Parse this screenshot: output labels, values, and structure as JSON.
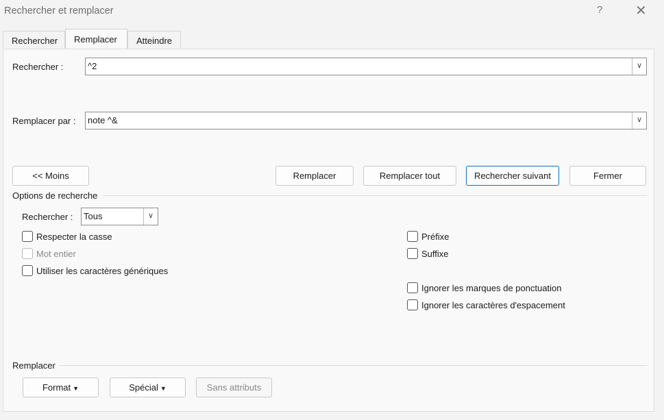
{
  "window": {
    "title": "Rechercher et remplacer",
    "help": "?",
    "close": "✕"
  },
  "tabs": [
    {
      "label": "Rechercher",
      "active": false
    },
    {
      "label": "Remplacer",
      "active": true
    },
    {
      "label": "Atteindre",
      "active": false
    }
  ],
  "find": {
    "label": "Rechercher :",
    "value": "^2"
  },
  "replace": {
    "label": "Remplacer par :",
    "value": "note ^&"
  },
  "buttons": {
    "less": "<< Moins",
    "replace": "Remplacer",
    "replace_all": "Remplacer tout",
    "find_next": "Rechercher suivant",
    "close": "Fermer"
  },
  "search_options": {
    "title": "Options de recherche",
    "direction_label": "Rechercher :",
    "direction_value": "Tous",
    "match_case": "Respecter la casse",
    "whole_word": "Mot entier",
    "wildcards": "Utiliser les caractères génériques",
    "prefix": "Préfixe",
    "suffix": "Suffixe",
    "ignore_punct": "Ignorer les marques de ponctuation",
    "ignore_space": "Ignorer les caractères d'espacement"
  },
  "replace_section": {
    "title": "Remplacer",
    "format": "Format",
    "special": "Spécial",
    "no_formatting": "Sans attributs"
  },
  "icons": {
    "dropdown": "chevron-down-icon",
    "caret": "caret-down-icon"
  }
}
